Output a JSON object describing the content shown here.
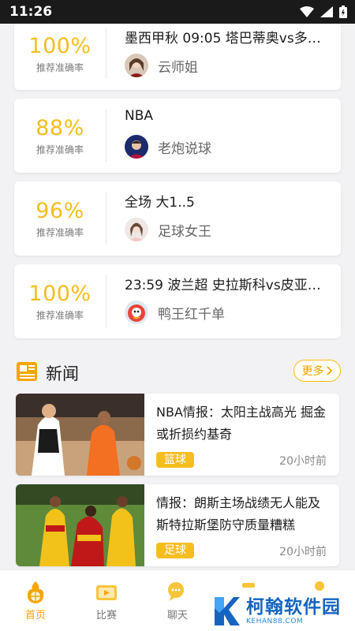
{
  "status_bar": {
    "time": "11:26"
  },
  "picks": [
    {
      "rate": "100%",
      "rate_label": "推荐准确率",
      "title": "墨西甲秋 09:05 塔巴蒂奥vs多…",
      "author": "云师姐"
    },
    {
      "rate": "88%",
      "rate_label": "推荐准确率",
      "title": "NBA",
      "author": "老炮说球"
    },
    {
      "rate": "96%",
      "rate_label": "推荐准确率",
      "title": "全场 大1..5",
      "author": "足球女王"
    },
    {
      "rate": "100%",
      "rate_label": "推荐准确率",
      "title": "23:59 波兰超 史拉斯科vs皮亚…",
      "author": "鸭王红千单"
    }
  ],
  "news": {
    "title": "新闻",
    "more_label": "更多",
    "items": [
      {
        "headline": "NBA情报：太阳主战高光 掘金或折损约基奇",
        "tag": "篮球",
        "time": "20小时前"
      },
      {
        "headline": "情报：朗斯主场战绩无人能及 斯特拉斯堡防守质量糟糕",
        "tag": "足球",
        "time": "20小时前"
      }
    ]
  },
  "bottom_nav": [
    {
      "label": "首页",
      "icon": "home-basketball-icon",
      "active": true
    },
    {
      "label": "比赛",
      "icon": "match-icon",
      "active": false
    },
    {
      "label": "聊天",
      "icon": "chat-icon",
      "active": false
    }
  ],
  "watermark": {
    "title": "柯翰软件园",
    "subtitle": "KEHAN88.COM"
  },
  "colors": {
    "accent": "#f5bd1f",
    "accent_text": "#e8a400",
    "brand_blue": "#1565c0"
  }
}
